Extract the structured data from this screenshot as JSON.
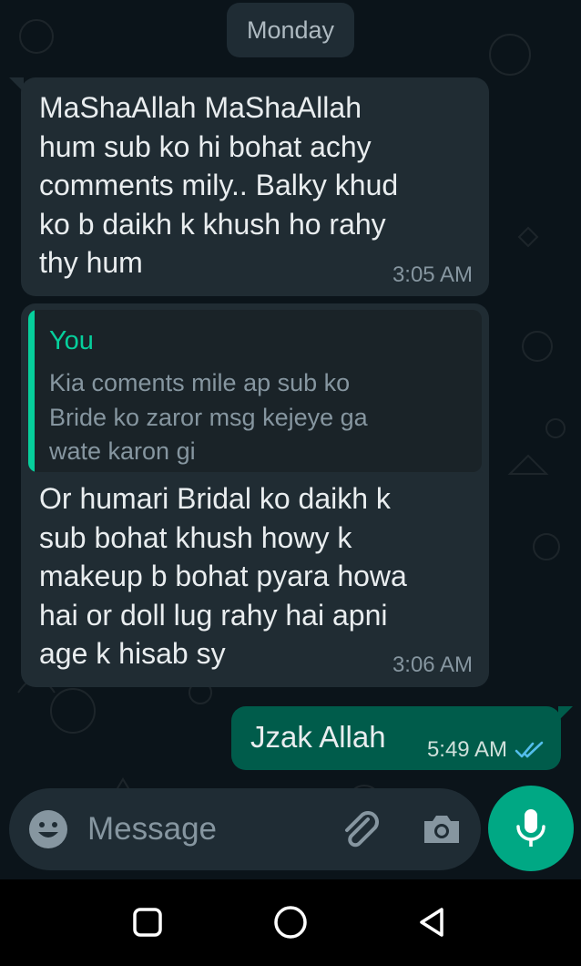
{
  "day_label": "Monday",
  "messages": [
    {
      "text": "MaShaAllah MaShaAllah\nhum sub ko hi bohat achy\ncomments mily.. Balky khud\nko b daikh k khush ho rahy\nthy hum",
      "time": "3:05 AM"
    },
    {
      "quote_author": "You",
      "quote_text": "Kia coments mile ap sub ko\nBride ko zaror msg kejeye ga\nwate karon gi",
      "text": "Or humari Bridal ko daikh k\nsub bohat khush howy k\nmakeup b bohat pyara howa\nhai or doll lug rahy hai apni\nage k hisab sy",
      "time": "3:06 AM"
    },
    {
      "text": "Jzak Allah",
      "time": "5:49 AM",
      "status": "read"
    }
  ],
  "composer": {
    "placeholder": "Message",
    "icons": [
      "emoji-icon",
      "attach-icon",
      "camera-icon",
      "mic-icon"
    ]
  },
  "nav": {
    "icons": [
      "recents-icon",
      "home-icon",
      "back-icon"
    ]
  },
  "colors": {
    "background": "#0b141a",
    "incoming_bubble": "#202c33",
    "outgoing_bubble": "#005c4b",
    "accent": "#00a884",
    "quote_author": "#06cf9c",
    "read_ticks": "#53bdeb"
  }
}
